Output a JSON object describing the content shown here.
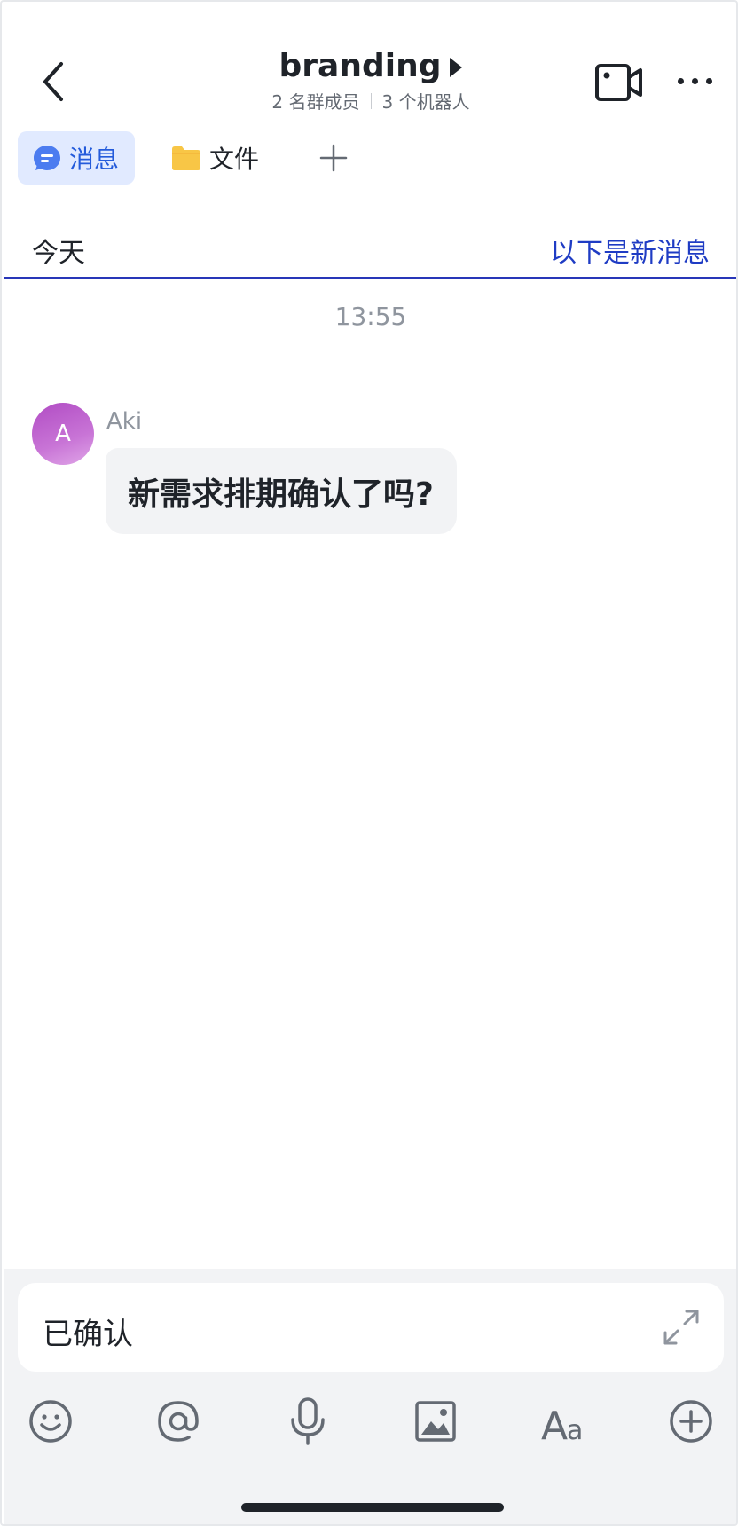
{
  "header": {
    "title": "branding",
    "members": "2 名群成员",
    "bots": "3 个机器人"
  },
  "tabs": {
    "messages": "消息",
    "files": "文件"
  },
  "timeline": {
    "date_label": "今天",
    "new_messages_label": "以下是新消息",
    "time": "13:55"
  },
  "message": {
    "avatar_initial": "A",
    "sender": "Aki",
    "text": "新需求排期确认了吗?"
  },
  "composer": {
    "value": "已确认"
  },
  "icons": {
    "back": "chevron-left-icon",
    "play": "play-triangle-icon",
    "video": "video-camera-icon",
    "more": "more-dots-icon",
    "message": "chat-bubble-icon",
    "folder": "folder-icon",
    "add": "plus-icon",
    "expand": "expand-icon",
    "emoji": "emoji-icon",
    "mention": "at-icon",
    "voice": "microphone-icon",
    "image": "image-icon",
    "format": "text-format-icon",
    "more_actions": "plus-circle-icon"
  },
  "colors": {
    "accent": "#245bdb",
    "new_message_line": "#2836b8",
    "tab_active_bg": "#e1eaff",
    "bubble_bg": "#f2f3f5",
    "avatar": "#b14cc4",
    "folder": "#f8c646"
  }
}
